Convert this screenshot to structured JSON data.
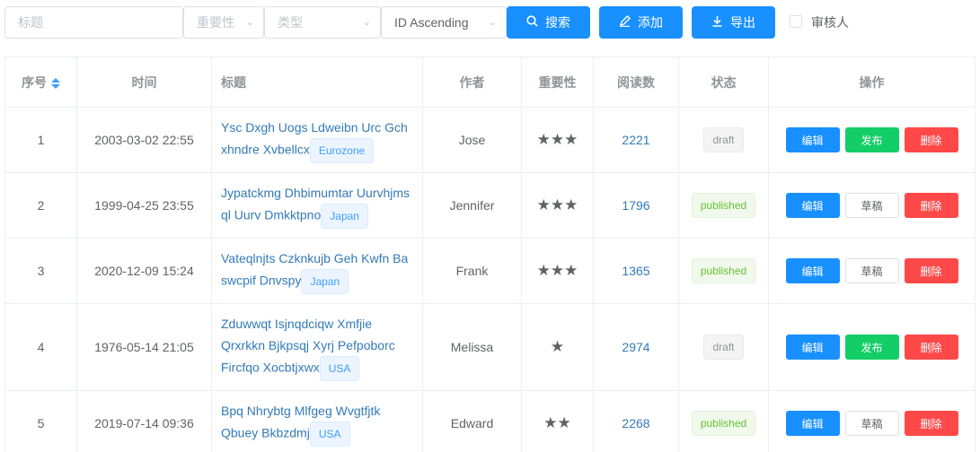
{
  "filters": {
    "title_placeholder": "标题",
    "importance_placeholder": "重要性",
    "type_placeholder": "类型",
    "sort_value": "ID Ascending",
    "search_label": "搜索",
    "add_label": "添加",
    "export_label": "导出",
    "reviewer_label": "审核人"
  },
  "colors": {
    "primary": "#1890ff",
    "success": "#13ce66",
    "danger": "#ff4949",
    "link": "#337ab7"
  },
  "table": {
    "headers": [
      "序号",
      "时间",
      "标题",
      "作者",
      "重要性",
      "阅读数",
      "状态",
      "操作"
    ],
    "rows": [
      {
        "id": "1",
        "time": "2003-03-02 22:55",
        "title": "Ysc Dxgh Uogs Ldweibn Urc Gch xhndre Xvbellcx",
        "tag": "Eurozone",
        "author": "Jose",
        "stars": "★★★",
        "importance": 3,
        "reads": "2221",
        "status": "draft",
        "actions": [
          "编辑",
          "发布",
          "删除"
        ]
      },
      {
        "id": "2",
        "time": "1999-04-25 23:55",
        "title": "Jypatckmg Dhbimumtar Uurvhjms ql Uurv Dmkktpno",
        "tag": "Japan",
        "author": "Jennifer",
        "stars": "★★★",
        "importance": 3,
        "reads": "1796",
        "status": "published",
        "actions": [
          "编辑",
          "草稿",
          "删除"
        ]
      },
      {
        "id": "3",
        "time": "2020-12-09 15:24",
        "title": "Vateqlnjts Czknkujb Geh Kwfn Ba swcpif Dnvspy",
        "tag": "Japan",
        "author": "Frank",
        "stars": "★★★",
        "importance": 3,
        "reads": "1365",
        "status": "published",
        "actions": [
          "编辑",
          "草稿",
          "删除"
        ]
      },
      {
        "id": "4",
        "time": "1976-05-14 21:05",
        "title": "Zduwwqt Isjnqdciqw Xmfjie Qrxrkkn Bjkpsqj Xyrj Pefpoborc Fircfqo Xocbtjxwx",
        "tag": "USA",
        "author": "Melissa",
        "stars": "★",
        "importance": 1,
        "reads": "2974",
        "status": "draft",
        "actions": [
          "编辑",
          "发布",
          "删除"
        ]
      },
      {
        "id": "5",
        "time": "2019-07-14 09:36",
        "title": "Bpq Nhrybtg Mlfgeg Wvgtfjtk Qbuey Bkbzdmj",
        "tag": "USA",
        "author": "Edward",
        "stars": "★★",
        "importance": 2,
        "reads": "2268",
        "status": "published",
        "actions": [
          "编辑",
          "草稿",
          "删除"
        ]
      }
    ]
  }
}
